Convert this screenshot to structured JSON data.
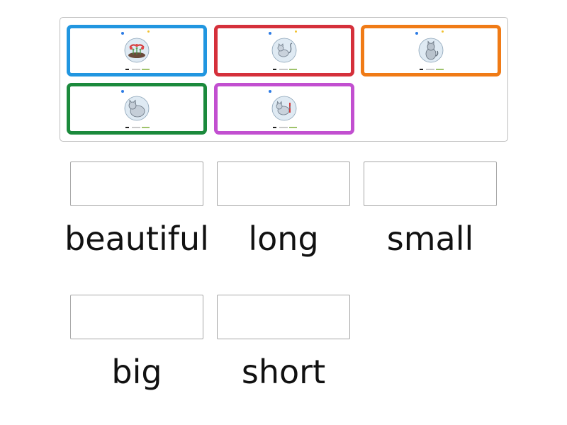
{
  "bank": {
    "cards": [
      {
        "name": "card-flowers",
        "border_color": "#2196e0",
        "picture": "flowers-icon"
      },
      {
        "name": "card-long-tail-cat",
        "border_color": "#d5303b",
        "picture": "cat-long-tail-icon"
      },
      {
        "name": "card-sitting-cat",
        "border_color": "#f07b16",
        "picture": "cat-sitting-icon"
      },
      {
        "name": "card-big-cat",
        "border_color": "#1b8a3c",
        "picture": "cat-big-icon"
      },
      {
        "name": "card-short-tail-cat",
        "border_color": "#c24fd0",
        "picture": "cat-short-tail-icon"
      }
    ]
  },
  "targets": [
    {
      "label": "beautiful"
    },
    {
      "label": "long"
    },
    {
      "label": "small"
    },
    {
      "label": "big"
    },
    {
      "label": "short"
    }
  ]
}
